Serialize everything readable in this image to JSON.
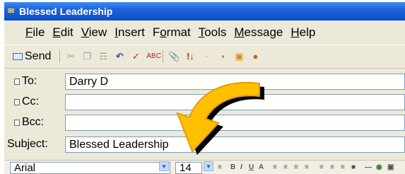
{
  "window": {
    "title": "Blessed Leadership"
  },
  "menu": [
    {
      "label": "File",
      "accel": "F",
      "rest": "ile"
    },
    {
      "label": "Edit",
      "accel": "E",
      "rest": "dit"
    },
    {
      "label": "View",
      "accel": "V",
      "rest": "iew"
    },
    {
      "label": "Insert",
      "accel": "I",
      "rest": "nsert"
    },
    {
      "label": "Format",
      "pre": "F",
      "accel": "o",
      "rest": "rmat"
    },
    {
      "label": "Tools",
      "accel": "T",
      "rest": "ools"
    },
    {
      "label": "Message",
      "accel": "M",
      "rest": "essage"
    },
    {
      "label": "Help",
      "accel": "H",
      "rest": "elp"
    }
  ],
  "toolbar": {
    "send_label": "Send",
    "icons": [
      "cut-icon",
      "copy-icon",
      "paste-icon",
      "undo-icon",
      "check-names-icon",
      "spelling-icon",
      "attach-icon",
      "priority-icon",
      "sign-icon",
      "encrypt-icon",
      "offline-icon"
    ]
  },
  "fields": {
    "to": {
      "label": "To:",
      "value": "Darry D"
    },
    "cc": {
      "label": "Cc:",
      "value": ""
    },
    "bcc": {
      "label": "Bcc:",
      "value": ""
    },
    "subject": {
      "label": "Subject:",
      "value": "Blessed Leadership"
    }
  },
  "format": {
    "font": "Arial",
    "size": "14"
  },
  "colors": {
    "titlebar": "#0b4fc9",
    "arrow_fill": "#ffc000",
    "arrow_outline": "#e39c00",
    "chrome": "#ece9d8"
  }
}
